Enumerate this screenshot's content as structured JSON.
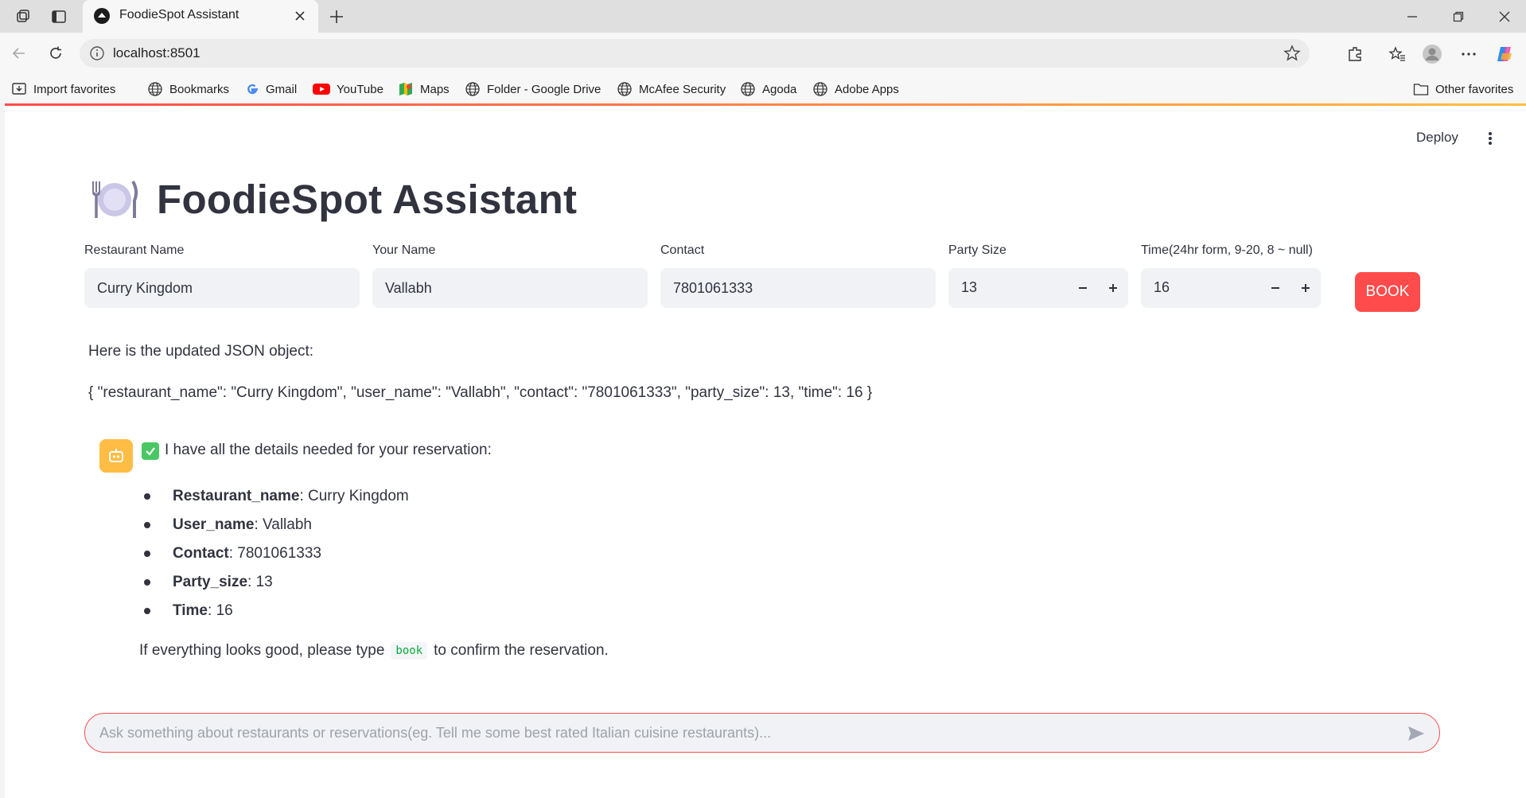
{
  "browser": {
    "tab_title": "FoodieSpot Assistant",
    "url": "localhost:8501",
    "bookmarks": [
      {
        "label": "Import favorites",
        "icon": "import-icon"
      },
      {
        "label": "Bookmarks",
        "icon": "globe-icon"
      },
      {
        "label": "Gmail",
        "icon": "google-icon"
      },
      {
        "label": "YouTube",
        "icon": "youtube-icon"
      },
      {
        "label": "Maps",
        "icon": "maps-icon"
      },
      {
        "label": "Folder - Google Drive",
        "icon": "globe-icon"
      },
      {
        "label": "McAfee Security",
        "icon": "globe-icon"
      },
      {
        "label": "Agoda",
        "icon": "globe-icon"
      },
      {
        "label": "Adobe Apps",
        "icon": "globe-icon"
      }
    ],
    "other_favorites": "Other favorites"
  },
  "app": {
    "deploy_label": "Deploy",
    "title": "FoodieSpot Assistant",
    "title_icon": "plate-fork-knife-icon",
    "accent_color": "#ff4b4b"
  },
  "form": {
    "restaurant": {
      "label": "Restaurant Name",
      "value": "Curry Kingdom"
    },
    "user": {
      "label": "Your Name",
      "value": "Vallabh"
    },
    "contact": {
      "label": "Contact",
      "value": "7801061333"
    },
    "party": {
      "label": "Party Size",
      "value": "13"
    },
    "time": {
      "label": "Time(24hr form, 9-20, 8 ~ null)",
      "value": "16"
    },
    "book_label": "BOOK"
  },
  "messages": {
    "updated_json_intro": "Here is the updated JSON object:",
    "json_text": "{ \"restaurant_name\": \"Curry Kingdom\", \"user_name\": \"Vallabh\", \"contact\": \"7801061333\", \"party_size\": 13, \"time\": 16 }",
    "assistant": {
      "intro": "I have all the details needed for your reservation:",
      "details": [
        {
          "key": "Restaurant_name",
          "value": ": Curry Kingdom"
        },
        {
          "key": "User_name",
          "value": ": Vallabh"
        },
        {
          "key": "Contact",
          "value": ": 7801061333"
        },
        {
          "key": "Party_size",
          "value": ": 13"
        },
        {
          "key": "Time",
          "value": ": 16"
        }
      ],
      "confirm_before": "If everything looks good, please type",
      "confirm_code": "book",
      "confirm_after": "to confirm the reservation."
    }
  },
  "chat_input": {
    "placeholder": "Ask something about restaurants or reservations(eg. Tell me some best rated Italian cuisine restaurants)..."
  }
}
